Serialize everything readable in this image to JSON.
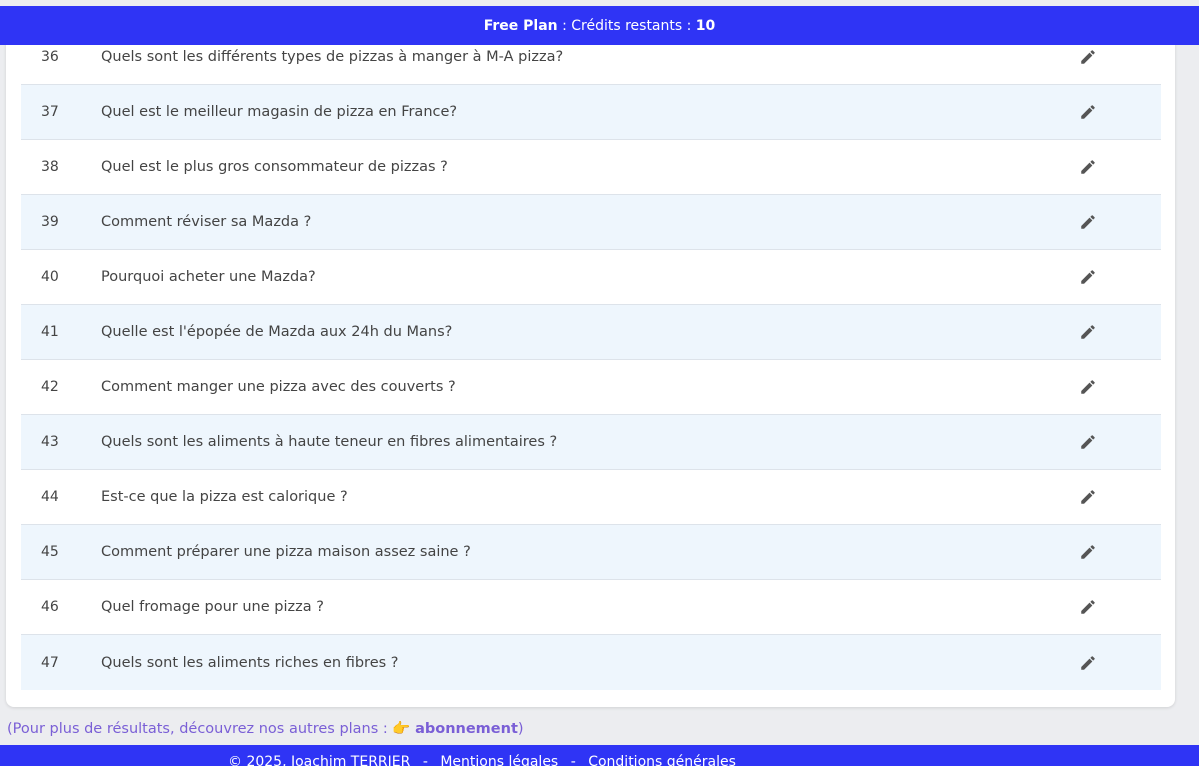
{
  "banner": {
    "plan": "Free Plan",
    "credits_label": " : Crédits restants : ",
    "credits_value": "10"
  },
  "questions": [
    {
      "num": "36",
      "text": "Quels sont les différents types de pizzas à manger à M-A pizza?"
    },
    {
      "num": "37",
      "text": "Quel est le meilleur magasin de pizza en France?"
    },
    {
      "num": "38",
      "text": "Quel est le plus gros consommateur de pizzas ?"
    },
    {
      "num": "39",
      "text": "Comment réviser sa Mazda ?"
    },
    {
      "num": "40",
      "text": "Pourquoi acheter une Mazda?"
    },
    {
      "num": "41",
      "text": "Quelle est l'épopée de Mazda aux 24h du Mans?"
    },
    {
      "num": "42",
      "text": "Comment manger une pizza avec des couverts ?"
    },
    {
      "num": "43",
      "text": "Quels sont les aliments à haute teneur en fibres alimentaires ?"
    },
    {
      "num": "44",
      "text": "Est-ce que la pizza est calorique ?"
    },
    {
      "num": "45",
      "text": "Comment préparer une pizza maison assez saine ?"
    },
    {
      "num": "46",
      "text": "Quel fromage pour une pizza ?"
    },
    {
      "num": "47",
      "text": "Quels sont les aliments riches en fibres ?"
    }
  ],
  "more": {
    "prefix": "(Pour plus de résultats, découvrez nos autres plans : ",
    "emoji": "👉",
    "link": "abonnement",
    "suffix": ")"
  },
  "footer": {
    "copyright": "© 2025, Joachim TERRIER",
    "separator": "-",
    "legal": "Mentions légales",
    "terms": "Conditions générales"
  },
  "icons": {
    "edit": "pencil-icon"
  },
  "colors": {
    "banner": "#2f34f5",
    "row_alt": "#eef6fd",
    "link": "#7a5fd6"
  }
}
